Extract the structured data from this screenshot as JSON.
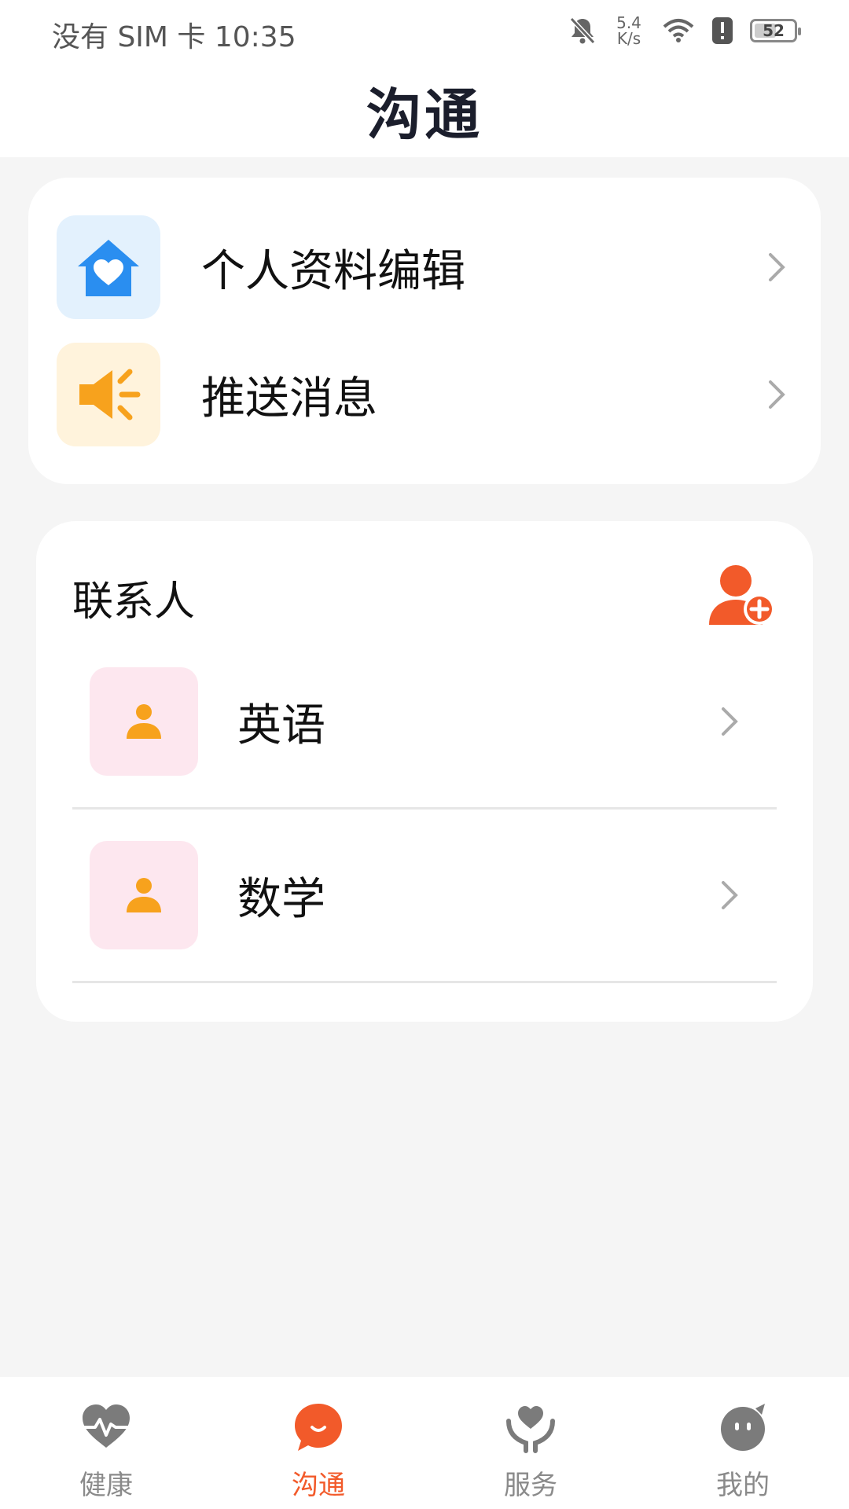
{
  "status_bar": {
    "carrier_time": "没有 SIM 卡 10:35",
    "net_speed_value": "5.4",
    "net_speed_unit": "K/s",
    "battery": "52"
  },
  "header": {
    "title": "沟通"
  },
  "menu": {
    "items": [
      {
        "label": "个人资料编辑",
        "icon": "home-heart-icon"
      },
      {
        "label": "推送消息",
        "icon": "speaker-icon"
      }
    ]
  },
  "contacts": {
    "title": "联系人",
    "add_icon": "add-person-icon",
    "items": [
      {
        "name": "英语"
      },
      {
        "name": "数学"
      }
    ]
  },
  "bottom_nav": {
    "items": [
      {
        "label": "健康",
        "icon": "heartbeat-icon"
      },
      {
        "label": "沟通",
        "icon": "chat-icon",
        "active": true
      },
      {
        "label": "服务",
        "icon": "hands-heart-icon"
      },
      {
        "label": "我的",
        "icon": "profile-face-icon"
      }
    ]
  },
  "colors": {
    "accent": "#f25a2a",
    "inactive": "#8a8a8a",
    "home_icon": "#2a8ef0",
    "speaker_icon": "#f7a21d",
    "contact_avatar_bg": "#fde7ef"
  }
}
